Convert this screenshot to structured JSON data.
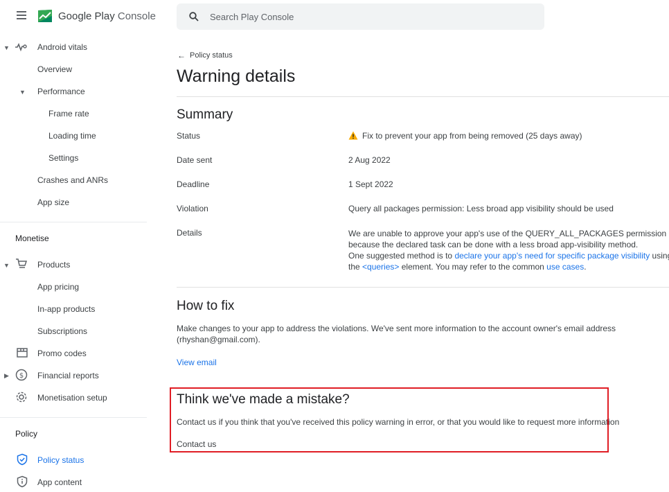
{
  "app": {
    "brand_primary": "Google Play",
    "brand_secondary": "Console"
  },
  "search": {
    "placeholder": "Search Play Console"
  },
  "sidebar": {
    "android_vitals": "Android vitals",
    "overview": "Overview",
    "performance": "Performance",
    "frame_rate": "Frame rate",
    "loading_time": "Loading time",
    "settings": "Settings",
    "crashes": "Crashes and ANRs",
    "app_size": "App size",
    "monetise_title": "Monetise",
    "products": "Products",
    "app_pricing": "App pricing",
    "in_app_products": "In-app products",
    "subscriptions": "Subscriptions",
    "promo_codes": "Promo codes",
    "financial_reports": "Financial reports",
    "monetisation_setup": "Monetisation setup",
    "policy_title": "Policy",
    "policy_status": "Policy status",
    "app_content": "App content"
  },
  "main": {
    "back_link": "Policy status",
    "page_title": "Warning details",
    "summary": {
      "title": "Summary",
      "status_label": "Status",
      "status_value": "Fix to prevent your app from being removed (25 days away)",
      "date_label": "Date sent",
      "date_value": "2 Aug 2022",
      "deadline_label": "Deadline",
      "deadline_value": "1 Sept 2022",
      "violation_label": "Violation",
      "violation_value": "Query all packages permission: Less broad app visibility should be used",
      "details_label": "Details",
      "details_line1": "We are unable to approve your app's use of the QUERY_ALL_PACKAGES permission",
      "details_line2": "because the declared task can be done with a less broad app-visibility method.",
      "details_line3_prefix": "One suggested method is to ",
      "details_line3_link": "declare your app's need for specific package visibility",
      "details_line3_suffix": " using",
      "details_line4_prefix": "the ",
      "details_line4_link": "<queries>",
      "details_line4_mid": " element. You may refer to the common ",
      "details_line4_link2": "use cases",
      "details_line4_suffix": "."
    },
    "how_to_fix": {
      "title": "How to fix",
      "line1": "Make changes to your app to address the violations. We've sent more information to the account owner's email address",
      "line2": "(rhyshan@gmail.com).",
      "view_email": "View email"
    },
    "mistake": {
      "title": "Think we've made a mistake?",
      "text": "Contact us if you think that you've received this policy warning in error, or that you would like to request more information",
      "contact": "Contact us"
    }
  },
  "colors": {
    "accent": "#1a73e8",
    "warning": "#f9ab00",
    "highlight": "#e01c24"
  }
}
